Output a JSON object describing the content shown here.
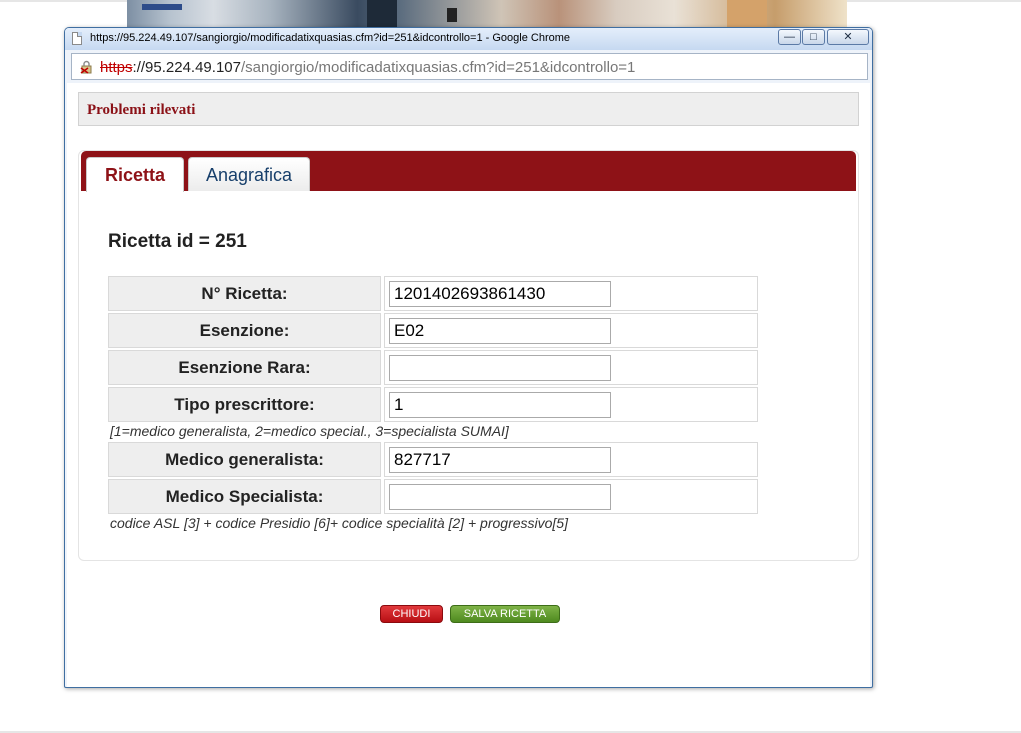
{
  "window": {
    "title": "https://95.224.49.107/sangiorgio/modificadatixquasias.cfm?id=251&idcontrollo=1 - Google Chrome",
    "controls": {
      "minimize": "—",
      "maximize": "□",
      "close": "✕"
    }
  },
  "urlbar": {
    "scheme": "https",
    "separator": "://",
    "host": "95.224.49.107",
    "path": "/sangiorgio/modificadatixquasias.cfm?id=251&idcontrollo=1",
    "icon": "broken-lock-icon"
  },
  "problemi": {
    "label": "Problemi rilevati"
  },
  "tabs": [
    {
      "label": "Ricetta",
      "active": true
    },
    {
      "label": "Anagrafica",
      "active": false
    }
  ],
  "heading": "Ricetta id = 251",
  "form": {
    "rows": [
      {
        "label": "N° Ricetta:",
        "value": "1201402693861430"
      },
      {
        "label": "Esenzione:",
        "value": "E02"
      },
      {
        "label": "Esenzione Rara:",
        "value": ""
      },
      {
        "label": "Tipo prescrittore:",
        "value": "1"
      },
      {
        "label": "Medico generalista:",
        "value": "827717"
      },
      {
        "label": "Medico Specialista:",
        "value": ""
      }
    ],
    "notes": {
      "tipo_prescrittore": "[1=medico generalista, 2=medico special., 3=specialista SUMAI]",
      "medico_specialista": "codice ASL [3] + codice Presidio [6]+ codice specialità [2] + progressivo[5]"
    }
  },
  "buttons": {
    "close": "CHIUDI",
    "save": "SALVA RICETTA"
  },
  "colors": {
    "accent": "#8e1217",
    "close_button": "#c8161b",
    "save_button": "#5e9a2c",
    "window_border": "#3f6ea1"
  }
}
